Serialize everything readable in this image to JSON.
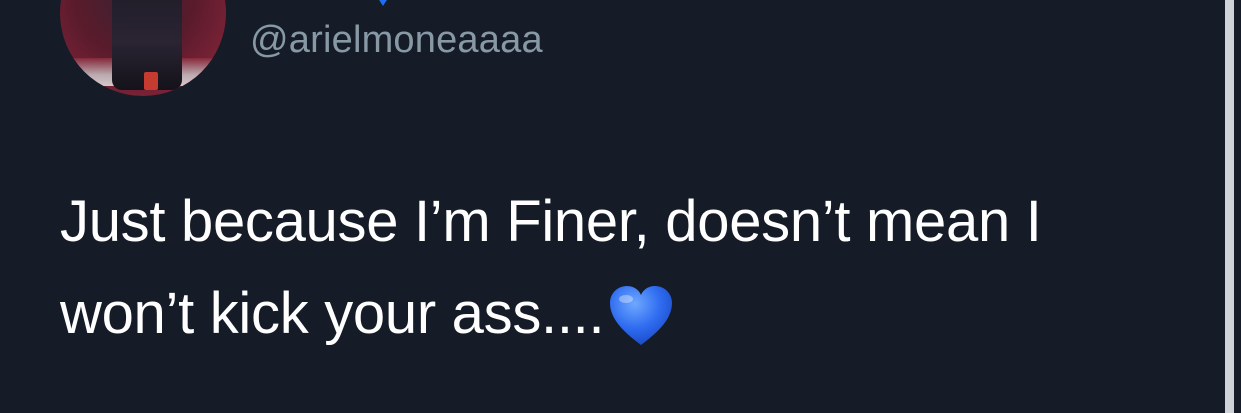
{
  "tweet": {
    "handle": "@arielmoneaaaa",
    "text": "Just because I’m Finer, doesn’t mean I won’t kick your ass....",
    "emoji": "blue-heart"
  },
  "colors": {
    "background": "#151c27",
    "text": "#ffffff",
    "handle": "#8899a6",
    "verified": "#1d9bf0",
    "heart": "#2f6cf0"
  }
}
